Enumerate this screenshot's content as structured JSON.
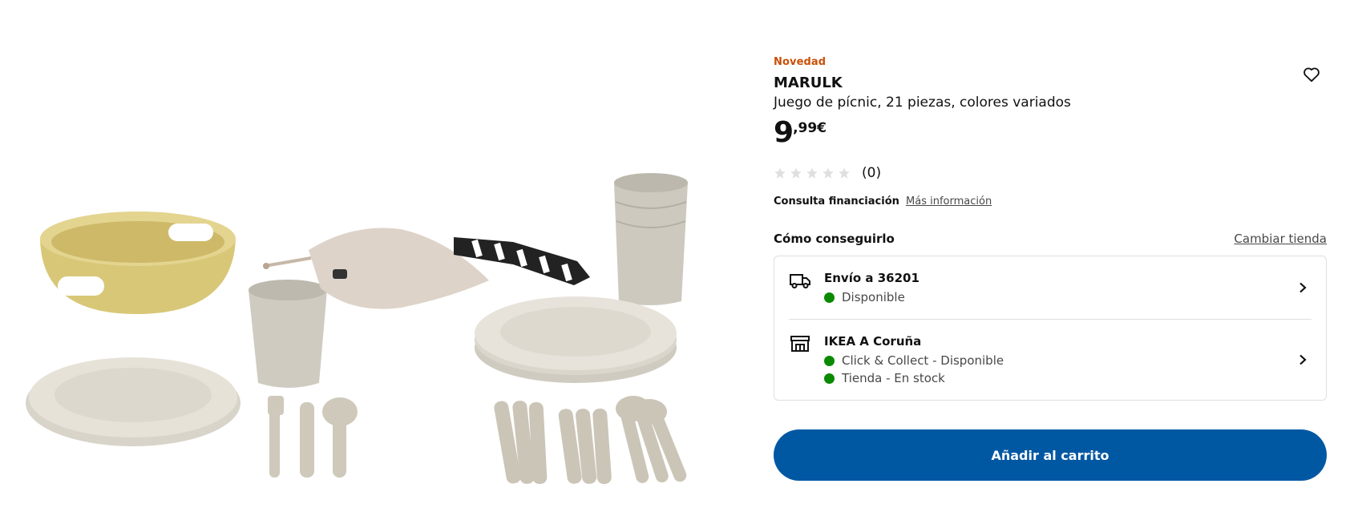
{
  "product": {
    "badge": "Novedad",
    "name": "MARULK",
    "description": "Juego de pícnic, 21 piezas, colores variados",
    "price_integer": "9",
    "price_decimal": ",99€",
    "rating_value": 0,
    "rating_max": 5,
    "rating_count": "(0)",
    "image_icon": "picnic-set-photo"
  },
  "finance": {
    "label": "Consulta financiación",
    "link": "Más información"
  },
  "availability": {
    "title": "Cómo conseguirlo",
    "change_store": "Cambiar tienda",
    "delivery": {
      "icon": "truck-icon",
      "title": "Envío a 36201",
      "status": "Disponible"
    },
    "store": {
      "icon": "store-icon",
      "title": "IKEA A Coruña",
      "status_1": "Click & Collect - Disponible",
      "status_2": "Tienda - En stock"
    }
  },
  "actions": {
    "add_to_cart": "Añadir al carrito",
    "favorite_icon": "heart-icon"
  },
  "colors": {
    "badge": "#ca5008",
    "primary_button": "#0058a3",
    "status_green": "#0a8a00",
    "star_empty": "#dfdfdf"
  }
}
